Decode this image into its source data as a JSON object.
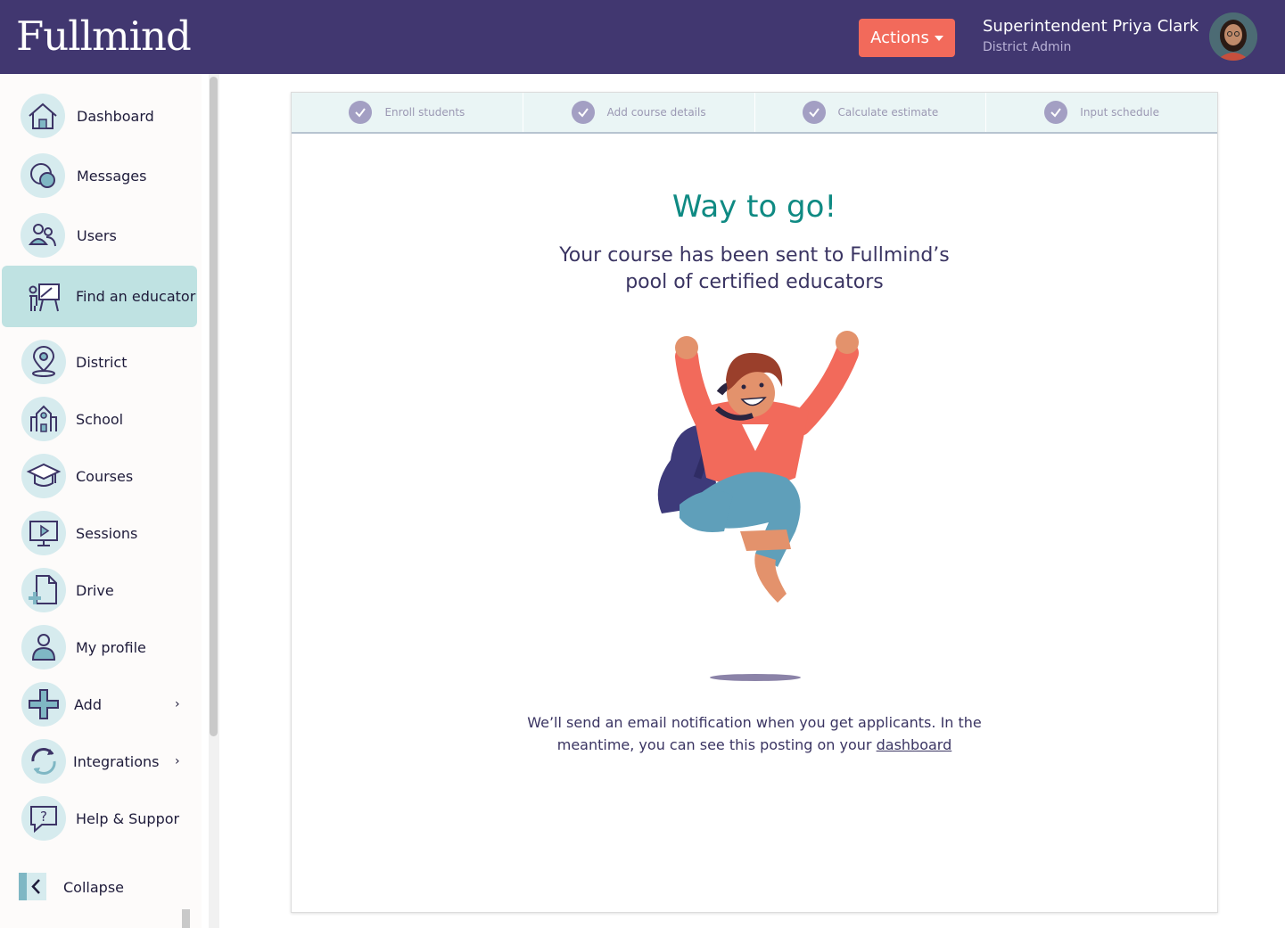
{
  "header": {
    "logo": "Fullmind",
    "actions_label": "Actions",
    "user_name": "Superintendent Priya Clark",
    "user_role": "District Admin"
  },
  "sidebar": {
    "items": [
      {
        "label": "Dashboard",
        "icon": "home-icon"
      },
      {
        "label": "Messages",
        "icon": "messages-icon"
      },
      {
        "label": "Users",
        "icon": "users-icon"
      },
      {
        "label": "Find an educator",
        "icon": "educator-icon",
        "active": true
      },
      {
        "label": "District",
        "icon": "location-pin-icon"
      },
      {
        "label": "School",
        "icon": "school-icon"
      },
      {
        "label": "Courses",
        "icon": "graduation-cap-icon"
      },
      {
        "label": "Sessions",
        "icon": "video-screen-icon"
      },
      {
        "label": "Drive",
        "icon": "file-add-icon"
      },
      {
        "label": "My profile",
        "icon": "profile-icon"
      },
      {
        "label": "Add",
        "icon": "plus-icon"
      },
      {
        "label": "Integrations",
        "icon": "sync-icon"
      },
      {
        "label": "Help & Suppor",
        "icon": "help-chat-icon"
      }
    ],
    "collapse_label": "Collapse"
  },
  "steps": [
    {
      "label": "Enroll students",
      "done": true
    },
    {
      "label": "Add course details",
      "done": true
    },
    {
      "label": "Calculate estimate",
      "done": true
    },
    {
      "label": "Input schedule",
      "done": true
    }
  ],
  "main": {
    "headline": "Way to go!",
    "sub_line1": "Your course has been sent to Fullmind’s",
    "sub_line2": "pool of certified educators",
    "notice_line1": "We’ll send an email notification when you get applicants.  In the",
    "notice_line2": "meantime, you can see this posting on your",
    "notice_link": "dashboard"
  },
  "colors": {
    "header_bg": "#413770",
    "accent_coral": "#f26a5b",
    "teal_headline": "#0f8a83",
    "active_nav": "#bfe2e2"
  }
}
